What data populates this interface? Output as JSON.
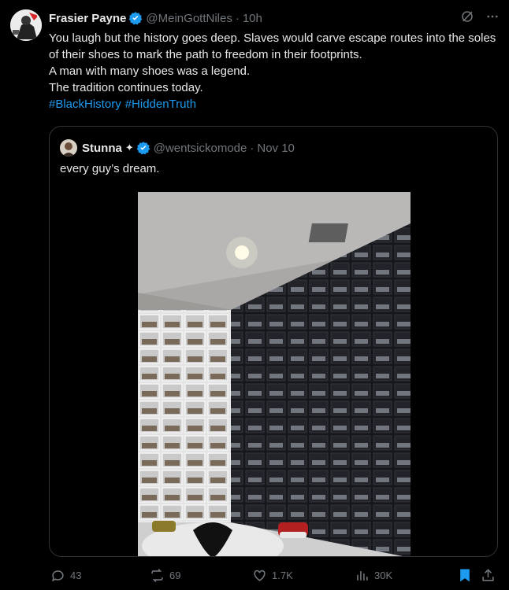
{
  "tweet": {
    "author": {
      "display_name": "Frasier Payne",
      "handle": "@MeinGottNiles",
      "time": "10h"
    },
    "lines": [
      "You laugh but the history goes deep. Slaves would carve escape routes into the soles of their shoes to mark the path to freedom in their footprints.",
      "A man with many shoes was a legend.",
      "The tradition continues today."
    ],
    "hashtags": [
      "#BlackHistory",
      "#HiddenTruth"
    ],
    "more_icon": "more-horizontal",
    "grok_icon": "grok-slash-circle"
  },
  "quote": {
    "display_name": "Stunna",
    "star": "✦",
    "handle": "@wentsickomode",
    "date": "Nov 10",
    "text": "every guy’s dream."
  },
  "actions": {
    "replies": "43",
    "reposts": "69",
    "likes": "1.7K",
    "views": "30K"
  },
  "colors": {
    "background": "#000000",
    "text": "#e7e9ea",
    "muted": "#71767b",
    "accent": "#1d9bf0",
    "border": "#2f3336"
  }
}
